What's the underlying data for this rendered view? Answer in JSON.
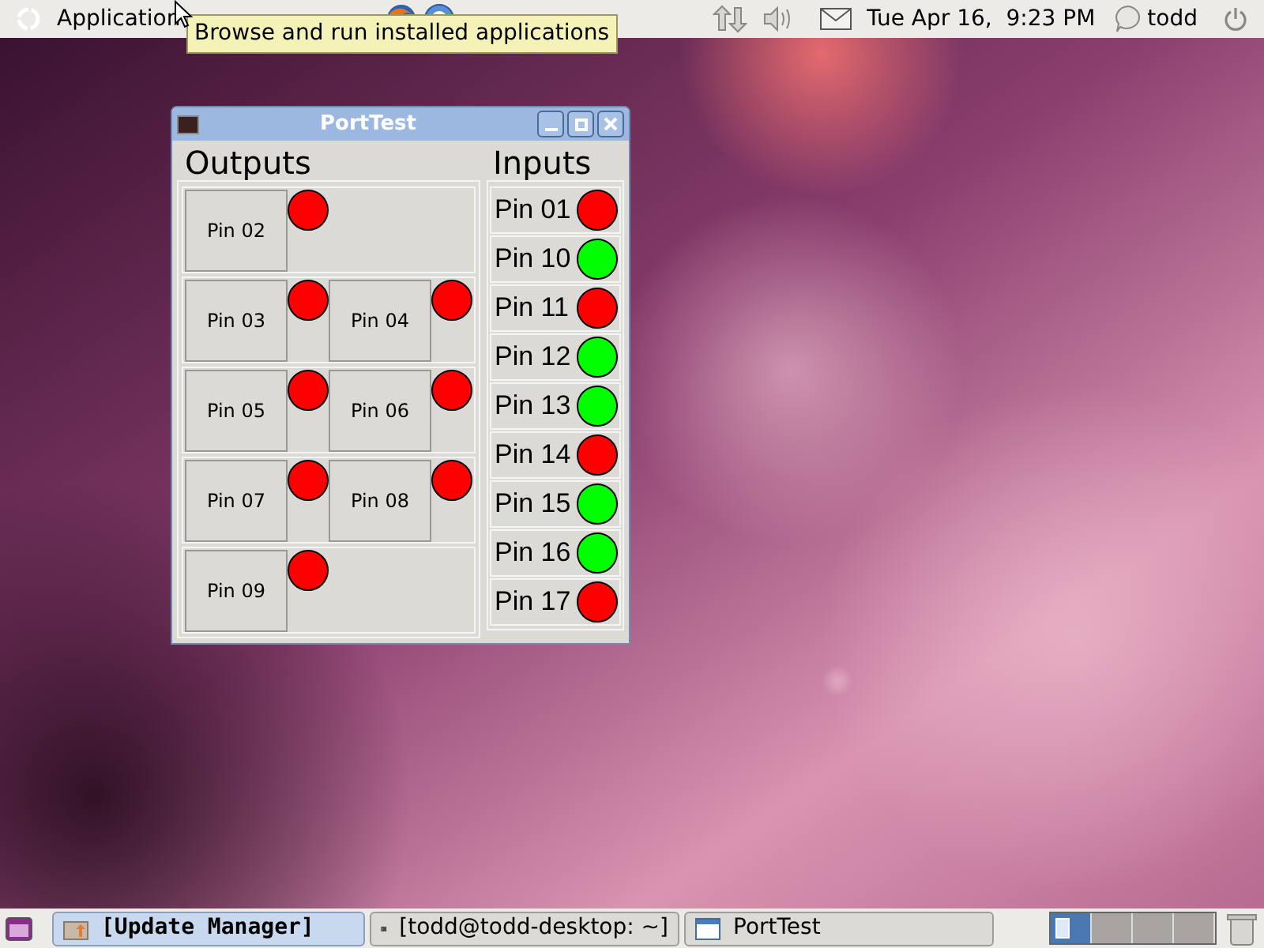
{
  "top_panel": {
    "menus": [
      "Application"
    ],
    "clock": "Tue Apr 16,  9:23 PM",
    "user": "todd"
  },
  "tooltip": "Browse and run installed applications",
  "window": {
    "title": "PortTest",
    "outputs": {
      "title": "Outputs",
      "rows": [
        [
          {
            "label": "Pin 02",
            "color": "#ff0000"
          }
        ],
        [
          {
            "label": "Pin 03",
            "color": "#ff0000"
          },
          {
            "label": "Pin 04",
            "color": "#ff0000"
          }
        ],
        [
          {
            "label": "Pin 05",
            "color": "#ff0000"
          },
          {
            "label": "Pin 06",
            "color": "#ff0000"
          }
        ],
        [
          {
            "label": "Pin 07",
            "color": "#ff0000"
          },
          {
            "label": "Pin 08",
            "color": "#ff0000"
          }
        ],
        [
          {
            "label": "Pin 09",
            "color": "#ff0000"
          }
        ]
      ]
    },
    "inputs": {
      "title": "Inputs",
      "items": [
        {
          "label": "Pin 01",
          "color": "#ff0000"
        },
        {
          "label": "Pin 10",
          "color": "#00ff00"
        },
        {
          "label": "Pin 11",
          "color": "#ff0000"
        },
        {
          "label": "Pin 12",
          "color": "#00ff00"
        },
        {
          "label": "Pin 13",
          "color": "#00ff00"
        },
        {
          "label": "Pin 14",
          "color": "#ff0000"
        },
        {
          "label": "Pin 15",
          "color": "#00ff00"
        },
        {
          "label": "Pin 16",
          "color": "#00ff00"
        },
        {
          "label": "Pin 17",
          "color": "#ff0000"
        }
      ]
    }
  },
  "taskbar": [
    {
      "label": "[Update Manager]",
      "selected": true,
      "kind": "update"
    },
    {
      "label": "[todd@todd-desktop: ~]",
      "selected": false,
      "kind": "terminal"
    },
    {
      "label": "PortTest",
      "selected": false,
      "kind": "window"
    }
  ],
  "workspaces": [
    {
      "selected": true
    },
    {
      "selected": false
    },
    {
      "selected": false
    },
    {
      "selected": false
    }
  ]
}
